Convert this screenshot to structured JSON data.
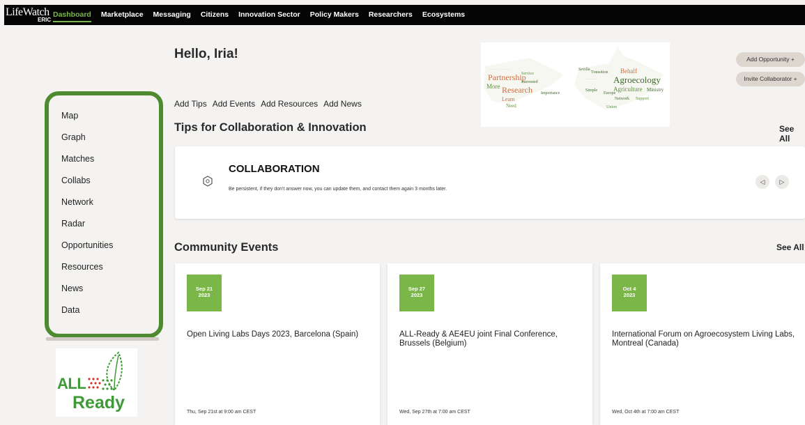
{
  "nav": {
    "logo_main": "LifeWatch",
    "logo_sub": "ERIC",
    "items": [
      {
        "label": "Dashboard"
      },
      {
        "label": "Marketplace"
      },
      {
        "label": "Messaging"
      },
      {
        "label": "Citizens"
      },
      {
        "label": "Innovation Sector"
      },
      {
        "label": "Policy Makers"
      },
      {
        "label": "Researchers"
      },
      {
        "label": "Ecosystems"
      }
    ],
    "accent_color": "#7ab648"
  },
  "sidebar": {
    "items": [
      {
        "label": "Map"
      },
      {
        "label": "Graph"
      },
      {
        "label": "Matches"
      },
      {
        "label": "Collabs"
      },
      {
        "label": "Network"
      },
      {
        "label": "Radar"
      },
      {
        "label": "Opportunities"
      },
      {
        "label": "Resources"
      },
      {
        "label": "News"
      },
      {
        "label": "Data"
      }
    ],
    "border_color": "#4e8a2f"
  },
  "brand_logo": {
    "line1": "ALL",
    "line2": "Ready",
    "color": "#3d9a36"
  },
  "main": {
    "greeting": "Hello, Iria!",
    "quick_links": [
      {
        "label": "Add Tips"
      },
      {
        "label": "Add Events"
      },
      {
        "label": "Add Resources"
      },
      {
        "label": "Add News"
      }
    ],
    "add_opportunity": "Add Opportunity +",
    "invite_collaborator": "Invite Collaborator +",
    "wordcloud_words": [
      "Partnership",
      "Research",
      "More",
      "Learn",
      "Need",
      "Agroecology",
      "Behalf",
      "Agriculture",
      "Ministry",
      "Network",
      "Interested",
      "Transition",
      "Importance",
      "Sevilla",
      "Union",
      "Support",
      "Simple",
      "Europe",
      "Service"
    ],
    "tips": {
      "section_title": "Tips for Collaboration & Innovation",
      "see_all": "See All",
      "card_title": "COLLABORATION",
      "card_body": "Be persistent, if they don't answer now, you can update them, and contact them again 3 months later.",
      "prev_icon": "triangle-left-icon",
      "next_icon": "triangle-right-icon"
    },
    "events": {
      "section_title": "Community Events",
      "see_all": "See All",
      "items": [
        {
          "date_line1": "Sep 21",
          "date_line2": "2023",
          "title": "Open Living Labs Days 2023, Barcelona (Spain)",
          "time": "Thu, Sep 21st at 9:00 am CEST"
        },
        {
          "date_line1": "Sep 27",
          "date_line2": "2023",
          "title": "ALL-Ready & AE4EU joint Final Conference, Brussels (Belgium)",
          "time": "Wed, Sep 27th at 7:00 am CEST"
        },
        {
          "date_line1": "Oct 4",
          "date_line2": "2023",
          "title": "International Forum on Agroecosystem Living Labs, Montreal (Canada)",
          "time": "Wed, Oct 4th at 7:00 am CEST"
        }
      ],
      "badge_color": "#7ab648"
    }
  }
}
